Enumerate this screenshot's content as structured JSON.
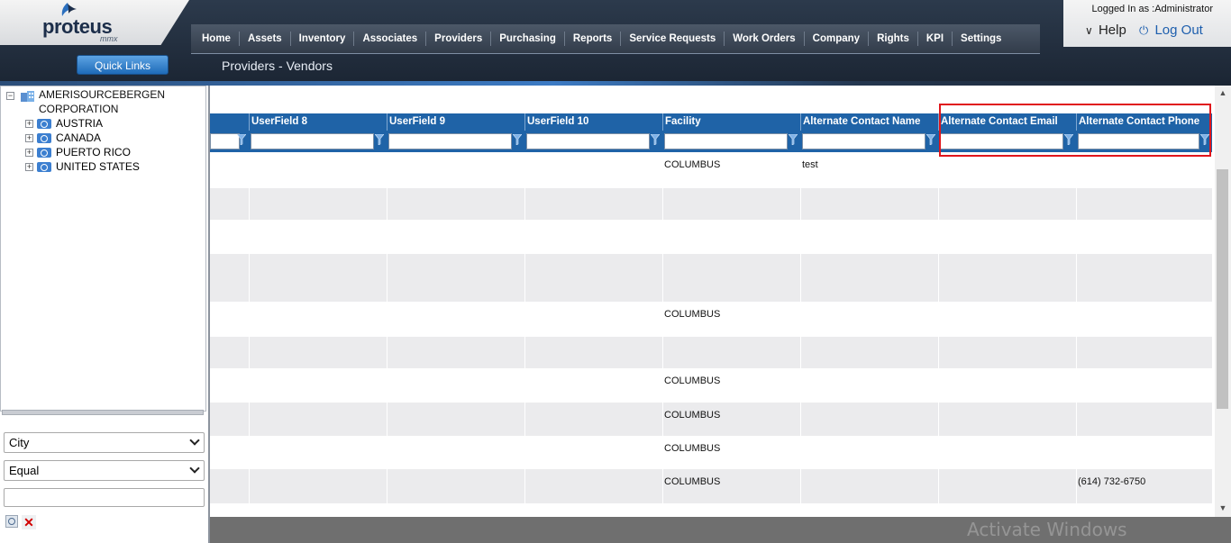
{
  "header": {
    "logo": {
      "name": "proteus",
      "sub": "mmx"
    },
    "logged_in": "Logged In as :Administrator",
    "help": "Help",
    "logout": "Log Out",
    "quick_links": "Quick Links",
    "page_title": "Providers - Vendors",
    "nav": [
      "Home",
      "Assets",
      "Inventory",
      "Associates",
      "Providers",
      "Purchasing",
      "Reports",
      "Service Requests",
      "Work Orders",
      "Company",
      "Rights",
      "KPI",
      "Settings"
    ]
  },
  "tree": {
    "root_line1": "AMERISOURCEBERGEN",
    "root_line2": "CORPORATION",
    "expander_minus": "−",
    "expander_plus": "+",
    "children": [
      "AUSTRIA",
      "CANADA",
      "PUERTO RICO",
      "UNITED STATES"
    ]
  },
  "filter": {
    "field": "City",
    "operator": "Equal",
    "value": "",
    "clear_glyph": "✕"
  },
  "grid": {
    "columns": [
      "",
      "UserField 8",
      "UserField 9",
      "UserField 10",
      "Facility",
      "Alternate Contact Name",
      "Alternate Contact Email",
      "Alternate Contact Phone"
    ],
    "rows": [
      [
        "",
        "",
        "",
        "",
        "COLUMBUS",
        "test",
        "",
        ""
      ],
      [
        "",
        "",
        "",
        "",
        "",
        "",
        "",
        ""
      ],
      [
        "",
        "",
        "",
        "",
        "",
        "",
        "",
        ""
      ],
      [
        "",
        "",
        "",
        "",
        "",
        "",
        "",
        ""
      ],
      [
        "",
        "",
        "",
        "",
        "COLUMBUS",
        "",
        "",
        ""
      ],
      [
        "",
        "",
        "",
        "",
        "",
        "",
        "",
        ""
      ],
      [
        "",
        "",
        "",
        "",
        "COLUMBUS",
        "",
        "",
        ""
      ],
      [
        "",
        "",
        "",
        "",
        "COLUMBUS",
        "",
        "",
        ""
      ],
      [
        "",
        "",
        "",
        "",
        "COLUMBUS",
        "",
        "",
        ""
      ],
      [
        "",
        "",
        "",
        "",
        "COLUMBUS",
        "",
        "",
        "(614) 732-6750"
      ],
      [
        "",
        "",
        "",
        "",
        "",
        "",
        "",
        ""
      ]
    ],
    "scroll_up": "▲",
    "scroll_down": "▼"
  },
  "watermark": "Activate Windows",
  "colors": {
    "header_blue": "#1f63a7",
    "highlight_red": "#e0161c",
    "alt_row": "#ebebed"
  }
}
